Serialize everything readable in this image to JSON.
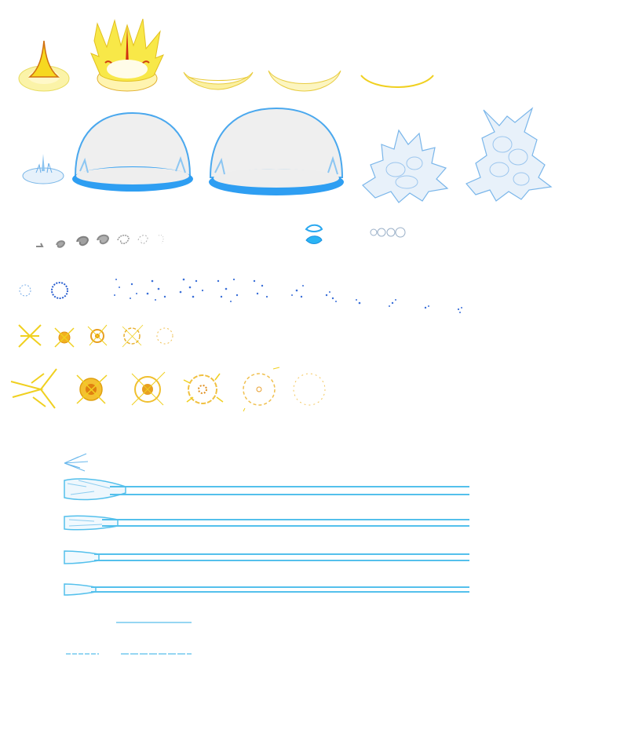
{
  "sheet": {
    "background": "#ffffff",
    "palette": {
      "aura_yellow": "#f6e84a",
      "aura_orange": "#e8a020",
      "aura_red": "#d03010",
      "dome_fill": "#eeeeee",
      "dome_blue": "#3aa8f0",
      "smoke_grey": "#9a9a9a",
      "spark_blue": "#3a6fd8",
      "spark_yellow": "#f0d020",
      "beam_blue": "#54c0ec"
    },
    "rows": [
      {
        "name": "yellow-aura-burst",
        "icon": "flame-aura-icon",
        "frames": 5
      },
      {
        "name": "blue-shield-dome",
        "icon": "energy-dome-icon",
        "frames": 5
      },
      {
        "name": "grey-smoke-puff",
        "icon": "smoke-puff-icon",
        "frames": 7
      },
      {
        "name": "blue-sparkle",
        "icon": "sparkle-icon",
        "frames": 11
      },
      {
        "name": "small-yellow-impact",
        "icon": "impact-star-icon",
        "frames": 5
      },
      {
        "name": "large-yellow-impact",
        "icon": "explosion-ring-icon",
        "frames": 6
      },
      {
        "name": "blue-energy-beam",
        "icon": "beam-icon",
        "frames": 7
      }
    ]
  }
}
